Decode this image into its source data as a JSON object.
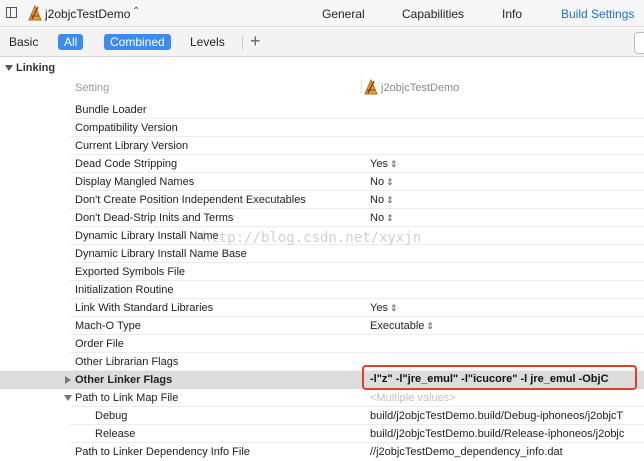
{
  "topbar": {
    "project_name": "j2objcTestDemo",
    "tabs": [
      "General",
      "Capabilities",
      "Info",
      "Build Settings"
    ]
  },
  "filterbar": {
    "basic": "Basic",
    "all": "All",
    "combined": "Combined",
    "levels": "Levels",
    "plus": "+"
  },
  "section": {
    "title": "Linking",
    "setting_col": "Setting",
    "target_col": "j2objcTestDemo"
  },
  "rows": [
    {
      "label": "Bundle Loader",
      "value": ""
    },
    {
      "label": "Compatibility Version",
      "value": ""
    },
    {
      "label": "Current Library Version",
      "value": ""
    },
    {
      "label": "Dead Code Stripping",
      "value": "Yes"
    },
    {
      "label": "Display Mangled Names",
      "value": "No"
    },
    {
      "label": "Don't Create Position Independent Executables",
      "value": "No"
    },
    {
      "label": "Don't Dead-Strip Inits and Terms",
      "value": "No"
    },
    {
      "label": "Dynamic Library Install Name",
      "value": ""
    },
    {
      "label": "Dynamic Library Install Name Base",
      "value": ""
    },
    {
      "label": "Exported Symbols File",
      "value": ""
    },
    {
      "label": "Initialization Routine",
      "value": ""
    },
    {
      "label": "Link With Standard Libraries",
      "value": "Yes"
    },
    {
      "label": "Mach-O Type",
      "value": "Executable"
    },
    {
      "label": "Order File",
      "value": ""
    },
    {
      "label": "Other Librarian Flags",
      "value": ""
    },
    {
      "label": "Other Linker Flags",
      "value": "-l\"z\" -l\"jre_emul\" -l\"icucore\" -l jre_emul -ObjC"
    },
    {
      "label": "Path to Link Map File",
      "value": "<Multiple values>"
    },
    {
      "label": "Debug",
      "value": "build/j2objcTestDemo.build/Debug-iphoneos/j2objcT"
    },
    {
      "label": "Release",
      "value": "build/j2objcTestDemo.build/Release-iphoneos/j2objc"
    },
    {
      "label": "Path to Linker Dependency Info File",
      "value": "//j2objcTestDemo_dependency_info.dat"
    }
  ],
  "watermark": "http://blog.csdn.net/xyxjn",
  "colors": {
    "accent": "#1a73d9",
    "pill": "#3b8cf2",
    "callout": "#e23d28",
    "highlight_row": "#dcdcdc"
  }
}
